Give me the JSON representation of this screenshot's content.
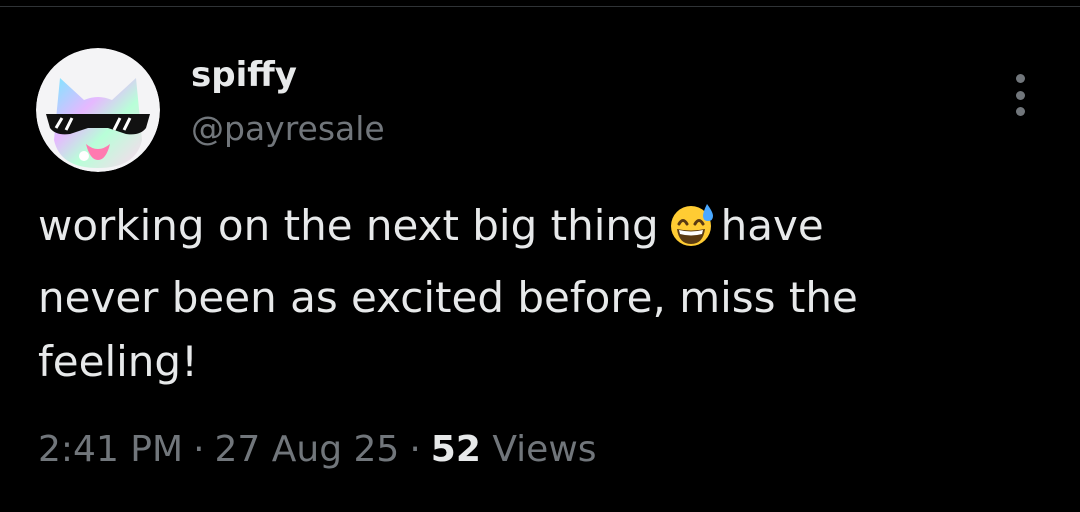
{
  "author": {
    "display_name": "spiffy",
    "handle": "@payresale"
  },
  "tweet": {
    "line1_before_emoji": "working on the next big thing",
    "line1_after_emoji": "have",
    "line2": "never been as excited before, miss the",
    "line3": "feeling!",
    "emoji": "grinning-face-with-sweat"
  },
  "meta": {
    "time": "2:41 PM",
    "separator": "·",
    "date": "27 Aug 25",
    "views_count": "52",
    "views_label": "Views"
  },
  "colors": {
    "background": "#000000",
    "primary_text": "#e7e9ea",
    "secondary_text": "#71767b"
  }
}
